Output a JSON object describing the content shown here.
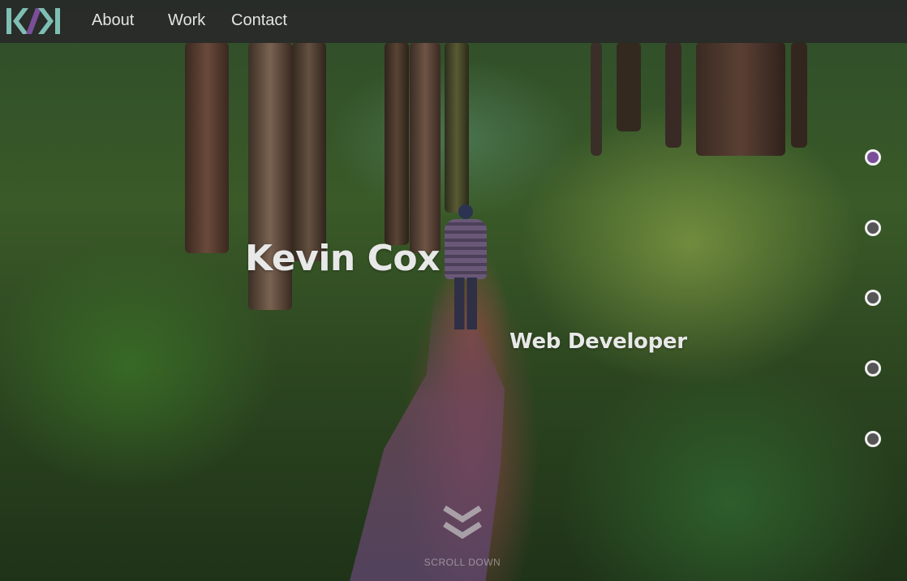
{
  "nav": {
    "logo_alt": "K/K",
    "links": [
      "About",
      "Work",
      "Contact"
    ]
  },
  "hero": {
    "name": "Kevin Cox",
    "role": "Web Developer"
  },
  "section_dots": {
    "count": 5,
    "active_index": 0
  },
  "scroll": {
    "label": "SCROLL DOWN"
  },
  "colors": {
    "logo_teal": "#7fbfb3",
    "logo_slash": "#7a4f98",
    "active_dot": "#7a4f98",
    "navbar_bg": "#282828"
  }
}
